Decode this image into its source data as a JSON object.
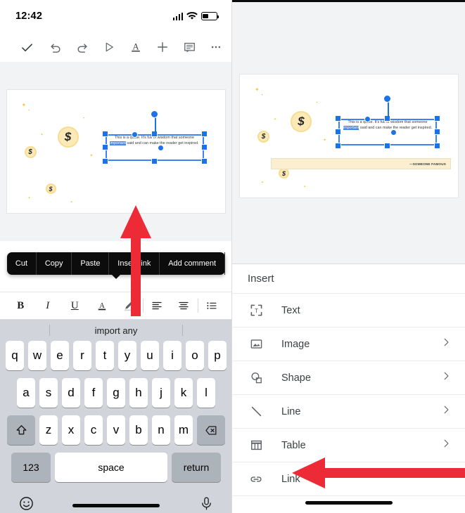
{
  "left": {
    "status": {
      "time": "12:42",
      "battery_pct": 42
    },
    "toolbar": {
      "check": "check-icon",
      "undo": "undo-icon",
      "redo": "redo-icon",
      "present": "present-icon",
      "text_format": "text-format-icon",
      "add": "add-icon",
      "comment": "comment-icon",
      "more": "more-icon"
    },
    "slide": {
      "quote_text": "This is a quote. It's full of wisdom that someone important said and can make the reader get inspired.",
      "highlighted_word": "important"
    },
    "context_menu": [
      "Cut",
      "Copy",
      "Paste",
      "Insert link",
      "Add comment"
    ],
    "format_toolbar": [
      "bold",
      "italic",
      "underline",
      "text-color",
      "highlight",
      "align-left",
      "align-center",
      "list"
    ],
    "keyboard": {
      "suggestion": "import any",
      "row1": [
        "q",
        "w",
        "e",
        "r",
        "t",
        "y",
        "u",
        "i",
        "o",
        "p"
      ],
      "row2": [
        "a",
        "s",
        "d",
        "f",
        "g",
        "h",
        "j",
        "k",
        "l"
      ],
      "row3": [
        "z",
        "x",
        "c",
        "v",
        "b",
        "n",
        "m"
      ],
      "shift": "shift-icon",
      "backspace": "backspace-icon",
      "numbers": "123",
      "space": "space",
      "return": "return",
      "emoji": "emoji-icon",
      "mic": "microphone-icon"
    }
  },
  "right": {
    "slide": {
      "quote_text": "This is a quote. It's full of wisdom that someone important said and can make the reader get inspired.",
      "highlighted_word": "important",
      "attribution": "—SOMEONE FAMOUS"
    },
    "insert_panel": {
      "title": "Insert",
      "items": [
        {
          "label": "Text",
          "icon": "text-box-icon",
          "has_chevron": false
        },
        {
          "label": "Image",
          "icon": "image-icon",
          "has_chevron": true
        },
        {
          "label": "Shape",
          "icon": "shape-icon",
          "has_chevron": true
        },
        {
          "label": "Line",
          "icon": "line-icon",
          "has_chevron": true
        },
        {
          "label": "Table",
          "icon": "table-icon",
          "has_chevron": true
        },
        {
          "label": "Link",
          "icon": "link-icon",
          "has_chevron": false
        }
      ]
    }
  },
  "annotations": {
    "arrow_color": "#ED2B37",
    "arrow_up_target": "Insert link",
    "arrow_left_target": "Link"
  }
}
